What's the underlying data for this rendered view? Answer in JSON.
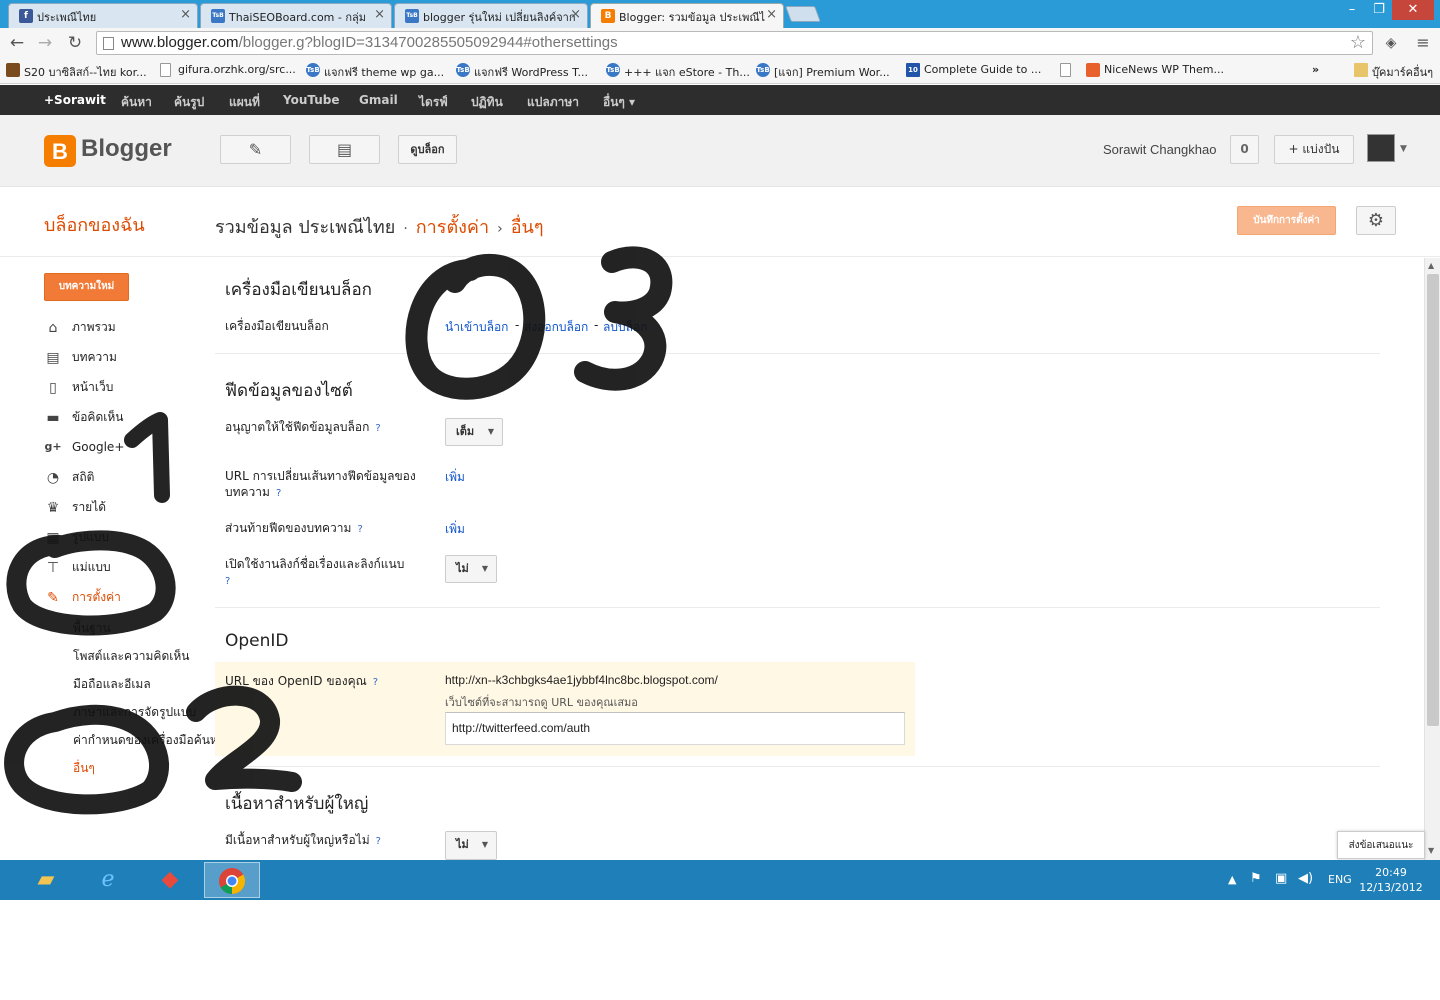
{
  "browser": {
    "tabs": [
      {
        "title": "ประเพณีไทย",
        "icon": "facebook-icon",
        "color": "#3b5998",
        "glyph": "f"
      },
      {
        "title": "ThaiSEOBoard.com - กลุ่ม",
        "icon": "tsb-icon",
        "color": "#3a78c6",
        "glyph": "TsB"
      },
      {
        "title": "blogger รุ่นใหม่ เปลี่ยนลิงค์จาก",
        "icon": "tsb-icon",
        "color": "#3a78c6",
        "glyph": "TsB"
      },
      {
        "title": "Blogger: รวมข้อมูล ประเพณีไ",
        "icon": "blogger-icon",
        "color": "#f57d00",
        "glyph": "B"
      }
    ],
    "url_host": "www.blogger.com",
    "url_path": "/blogger.g?blogID=3134700285505092944#othersettings",
    "window_controls": {
      "minimize": "–",
      "maximize": "❐",
      "close": "✕"
    }
  },
  "bookmarks": [
    {
      "label": "S20 บาซิลิสก์--ไทย kor...",
      "color": "#7a4b1e"
    },
    {
      "label": "gifura.orzhk.org/src...",
      "color": "#999999"
    },
    {
      "label": "แจกฟรี theme wp ga...",
      "color": "#3a78c6"
    },
    {
      "label": "แจกฟรี WordPress T...",
      "color": "#3a78c6"
    },
    {
      "label": "+++ แจก eStore - Th...",
      "color": "#3a78c6"
    },
    {
      "label": "[แจก] Premium Wor...",
      "color": "#3a78c6"
    },
    {
      "label": "Complete Guide to ...",
      "color": "#2255aa"
    },
    {
      "label": "",
      "color": "#999999"
    },
    {
      "label": "NiceNews WP Them...",
      "color": "#e8612c"
    }
  ],
  "bookmarks_more": "»",
  "bookmarks_folder": "บุ๊คมาร์คอื่นๆ",
  "gbar": [
    "+Sorawit",
    "ค้นหา",
    "ค้นรูป",
    "แผนที่",
    "YouTube",
    "Gmail",
    "ไดรฟ์",
    "ปฏิทิน",
    "แปลภาษา",
    "อื่นๆ ▾"
  ],
  "blogger": {
    "logo_text": "Blogger",
    "view_blog": "ดูบล็อก",
    "user_name": "Sorawit Changkhao",
    "notif_count": "0",
    "share_label": "+ แบ่งปัน"
  },
  "page": {
    "my_blogs": "บล็อกของฉัน",
    "blog_title": "รวมข้อมูล ประเพณีไทย",
    "crumb_settings": "การตั้งค่า",
    "crumb_other": "อื่นๆ",
    "save_button": "บันทึกการตั้งค่า"
  },
  "sidebar": {
    "new_post": "บทความใหม่",
    "items": [
      {
        "label": "ภาพรวม",
        "icon": "home-icon",
        "glyph": "⌂"
      },
      {
        "label": "บทความ",
        "icon": "posts-icon",
        "glyph": "▤"
      },
      {
        "label": "หน้าเว็บ",
        "icon": "pages-icon",
        "glyph": "▯"
      },
      {
        "label": "ข้อคิดเห็น",
        "icon": "comment-icon",
        "glyph": "▬"
      },
      {
        "label": "Google+",
        "icon": "google-plus-icon",
        "glyph": "g+"
      },
      {
        "label": "สถิติ",
        "icon": "stats-icon",
        "glyph": "◔"
      },
      {
        "label": "รายได้",
        "icon": "trophy-icon",
        "glyph": "♛"
      },
      {
        "label": "รูปแบบ",
        "icon": "layout-icon",
        "glyph": "▦"
      },
      {
        "label": "แม่แบบ",
        "icon": "paint-roller-icon",
        "glyph": "⊤"
      },
      {
        "label": "การตั้งค่า",
        "icon": "wrench-icon",
        "glyph": "✎"
      }
    ],
    "sub_items": [
      "พื้นฐาน",
      "โพสต์และความคิดเห็น",
      "มือถือและอีเมล",
      "ภาษาและการจัดรูปแบบ",
      "ค่ากำหนดของเครื่องมือค้นหา",
      "อื่นๆ"
    ]
  },
  "main": {
    "blog_tools_title": "เครื่องมือเขียนบล็อก",
    "blog_tools_label": "เครื่องมือเขียนบล็อก",
    "blog_tools_links": [
      "นำเข้าบล็อก",
      "ส่งออกบล็อก",
      "ลบบล็อก"
    ],
    "feed_title": "ฟีดข้อมูลของไซต์",
    "allow_feed_label": "อนุญาตให้ใช้ฟีดข้อมูลบล็อก",
    "allow_feed_value": "เต็ม",
    "redirect_label": "URL การเปลี่ยนเส้นทางฟีดข้อมูลของบทความ",
    "redirect_link": "เพิ่ม",
    "footer_label": "ส่วนท้ายฟีดของบทความ",
    "footer_link": "เพิ่ม",
    "title_links_label": "เปิดใช้งานลิงก์ชื่อเรื่องและลิงก์แนบ",
    "title_links_value": "ไม่",
    "openid_title": "OpenID",
    "openid_label": "URL ของ OpenID ของคุณ",
    "openid_url": "http://xn--k3chbgks4ae1jybbf4lnc8bc.blogspot.com/",
    "openid_hint": "เว็บไซต์ที่จะสามารถดู URL ของคุณเสมอ",
    "openid_input": "http://twitterfeed.com/auth",
    "adult_title": "เนื้อหาสำหรับผู้ใหญ่",
    "adult_label": "มีเนื้อหาสำหรับผู้ใหญ่หรือไม่",
    "adult_value": "ไม่",
    "help": "?",
    "feedback": "ส่งข้อเสนอแนะ"
  },
  "annotations": {
    "one": "1",
    "two": "2",
    "zero_a": "0",
    "three": "3"
  },
  "taskbar": {
    "apps": [
      {
        "icon": "file-explorer-icon"
      },
      {
        "icon": "internet-explorer-icon"
      },
      {
        "icon": "app-icon"
      },
      {
        "icon": "chrome-icon"
      }
    ],
    "lang": "ENG",
    "time": "20:49",
    "date": "12/13/2012"
  },
  "colors": {
    "blogger_orange": "#f57d00",
    "link_blue": "#1155cc",
    "taskbar": "#1f7fb8"
  }
}
